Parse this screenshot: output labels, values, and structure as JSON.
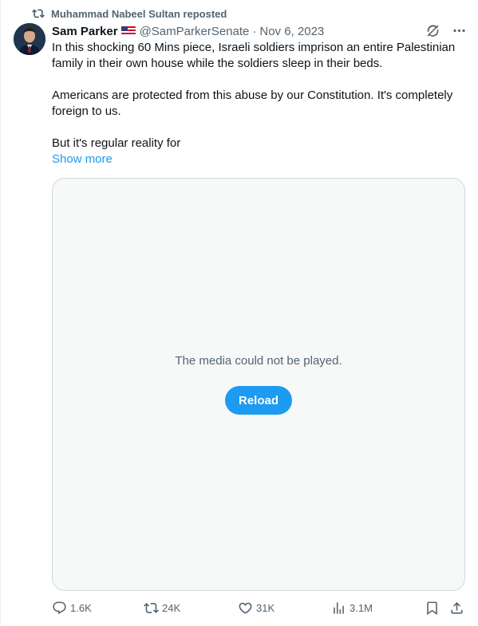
{
  "repost": {
    "text": "Muhammad Nabeel Sultan reposted",
    "icon": "repost-icon"
  },
  "author": {
    "name": "Sam Parker",
    "flag": "us-flag-icon",
    "handle": "@SamParkerSenate",
    "separator": "·",
    "date": "Nov 6, 2023"
  },
  "header_icons": [
    "grok-icon",
    "more-icon"
  ],
  "post": {
    "paragraphs": [
      "In this shocking 60 Mins piece, Israeli soldiers imprison an entire Palestinian family in their own house while the soldiers sleep in their beds.",
      "Americans are protected from this abuse by our Constitution. It's completely foreign to us.",
      "But it's regular reality for"
    ],
    "show_more": "Show more"
  },
  "media": {
    "message": "The media could not be played.",
    "reload_label": "Reload"
  },
  "actions": {
    "replies": "1.6K",
    "reposts": "24K",
    "likes": "31K",
    "views": "3.1M"
  },
  "colors": {
    "accent": "#1d9bf0",
    "secondary_text": "#536471",
    "border": "#cfd9de"
  }
}
